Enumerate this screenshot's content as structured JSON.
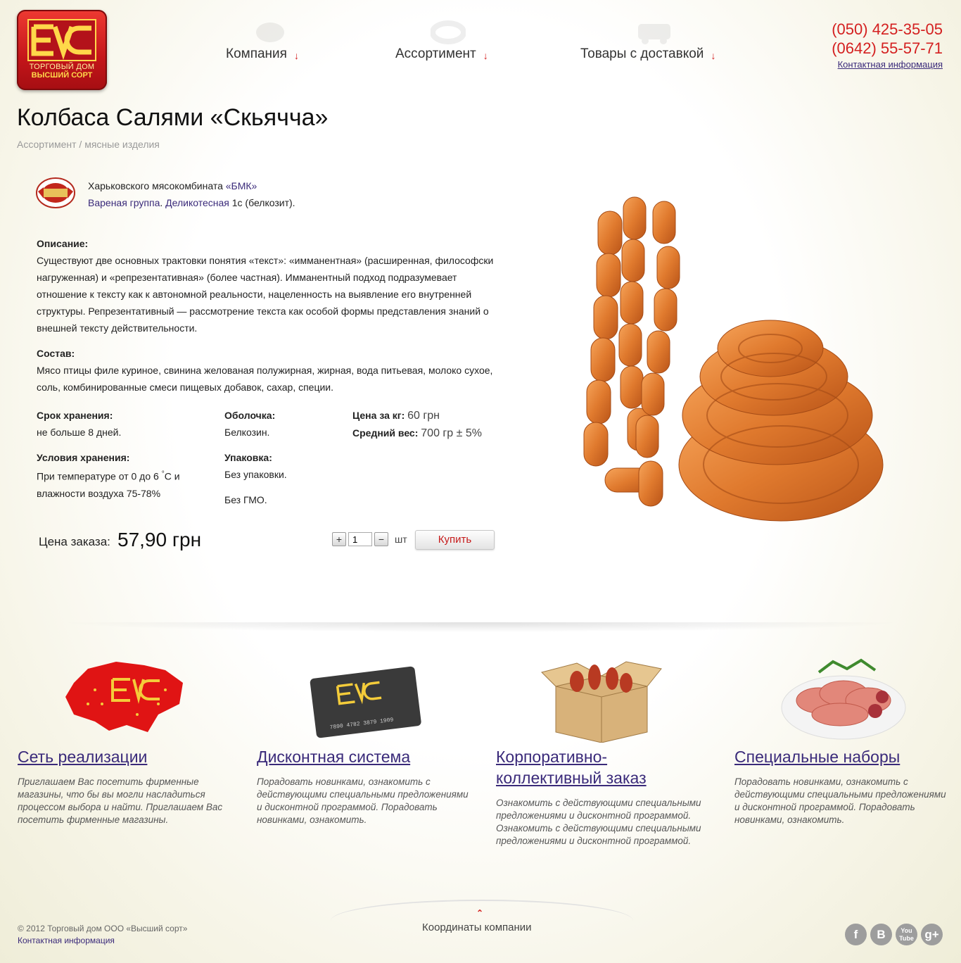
{
  "logo": {
    "line1": "ТОРГОВЫЙ ДОМ",
    "line2": "ВЫСШИЙ СОРТ"
  },
  "nav": [
    {
      "label": "Компания"
    },
    {
      "label": "Ассортимент"
    },
    {
      "label": "Товары с доставкой"
    }
  ],
  "contacts": {
    "phone1": "(050) 425-35-05",
    "phone2": "(0642) 55-57-71",
    "link": "Контактная информация"
  },
  "product": {
    "title": "Колбаса Салями «Скьячча»",
    "breadcrumb": "Ассортимент / мясные изделия",
    "producer_prefix": "Харьковского мясокомбината",
    "producer_link": "«БМК»",
    "group_link": "Вареная группа",
    "group_sep": ".",
    "type_link": "Деликотесная",
    "type_rest": "1с (белкозит).",
    "description_label": "Описание:",
    "description": "Существуют две основных трактовки понятия «текст»: «имманентная» (расширенная, философски нагруженная) и «репрезентативная» (более частная). Имманентный подход подразумевает отношение к тексту как к автономной реальности, нацеленность на выявление его внутренней структуры. Репрезентативный — рассмотрение текста как особой формы представления знаний о внешней тексту действительности.",
    "composition_label": "Состав:",
    "composition": "Мясо птицы филе куриное, свинина желованая полужирная, жирная, вода питьевая, молоко сухое, соль, комбинированные смеси пищевых добавок, сахар, специи.",
    "shelf_label": "Срок хранения:",
    "shelf_value": "не больше 8 дней.",
    "storage_label": "Условия хранения:",
    "storage_value_1": "При температуре от 0 до 6",
    "storage_deg": "°",
    "storage_value_2": "С и",
    "storage_value_3": "влажности воздуха 75-78%",
    "casing_label": "Оболочка:",
    "casing_value": "Белкозин.",
    "pack_label": "Упаковка:",
    "pack_value": "Без упаковки.",
    "gmo": "Без ГМО.",
    "price_kg_label": "Цена за кг:",
    "price_kg_value": "60 грн",
    "avg_weight_label": "Средний вес:",
    "avg_weight_value": "700 гр ± 5%",
    "order_label": "Цена заказа:",
    "order_price": "57,90 грн",
    "qty_plus": "+",
    "qty_value": "1",
    "qty_minus": "−",
    "qty_unit": "шт",
    "buy_label": "Купить"
  },
  "features": [
    {
      "title": "Сеть реализации",
      "text": "Приглашаем Вас посетить фирменные магазины, что бы вы могли насладиться процессом выбора и найти. Приглашаем Вас посетить фирменные магазины."
    },
    {
      "title": "Дисконтная система",
      "text": "Порадовать новинками, ознакомить с действующими специальными предложениями и дисконтной программой. Порадовать новинками, ознакомить.",
      "card_number": "7890 4782 3879 1909"
    },
    {
      "title_line1": "Корпоративно-",
      "title_line2": "коллективный заказ",
      "text": "Ознакомить с действующими специальными предложениями и дисконтной программой. Ознакомить с действующими специальными предложениями и дисконтной программой."
    },
    {
      "title": "Специальные наборы",
      "text": "Порадовать новинками, ознакомить с действующими специальными предложениями и дисконтной программой. Порадовать новинками, ознакомить."
    }
  ],
  "footer": {
    "copyright": "© 2012 Торговый дом ООО «Высший сорт»",
    "contact_link": "Контактная информация",
    "coords": "Координаты компании",
    "social": [
      {
        "icon": "facebook-icon",
        "glyph": "f"
      },
      {
        "icon": "vkontakte-icon",
        "glyph": "B"
      },
      {
        "icon": "youtube-icon",
        "glyph": "You Tube"
      },
      {
        "icon": "googleplus-icon",
        "glyph": "g+"
      }
    ]
  },
  "colors": {
    "accent_red": "#d42020",
    "link": "#3a2a7a"
  }
}
